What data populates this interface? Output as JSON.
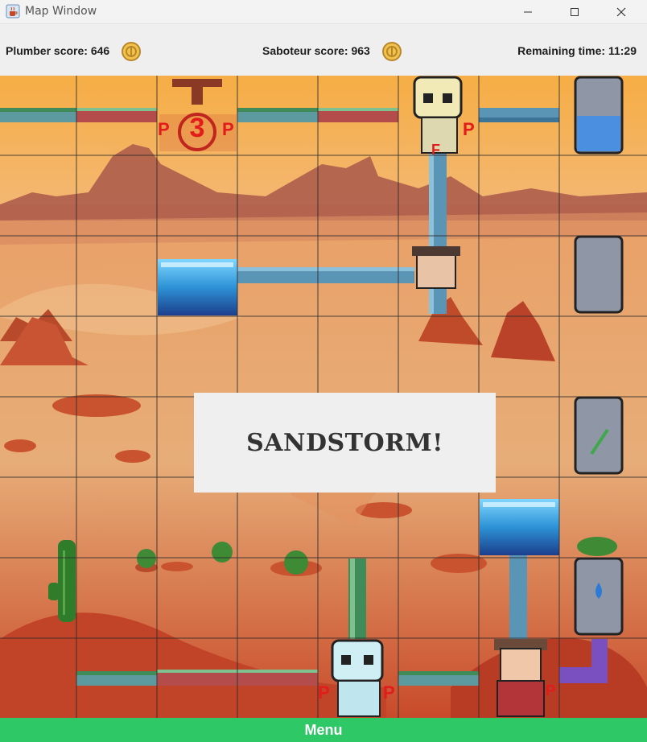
{
  "window": {
    "title": "Map Window",
    "icons": [
      "java-cup-icon",
      "minimize-icon",
      "maximize-icon",
      "close-icon"
    ]
  },
  "scores": {
    "plumber": "Plumber score: 646",
    "saboteur": "Saboteur score: 963",
    "time": "Remaining time: 11:29"
  },
  "board": {
    "grid": {
      "cols": 8,
      "rows": 8
    },
    "icons": [
      "cistern-icon",
      "spring-icon",
      "pump-icon",
      "plumber-icon",
      "saboteur-icon",
      "pipe-icon",
      "cactus-icon",
      "water-pool-icon",
      "coin-icon"
    ],
    "labels": {
      "pump_count": "3",
      "pump_left": "P",
      "pump_right": "P",
      "saboteur_top": "P",
      "saboteur_bottom": "P",
      "saboteur_bottom_left": "P",
      "plumber_small": "F",
      "plumber_bottom": "P"
    }
  },
  "overlay": {
    "text": "SANDSTORM!"
  },
  "menu": {
    "label": "Menu"
  },
  "colors": {
    "accent_green": "#2ec866",
    "sand": "#e8a465",
    "sky": "#f5a94f",
    "water": "#3aa0d8",
    "pipe_blue": "#5b95b5",
    "pipe_red": "#b04a4a",
    "pipe_purple": "#7a4fc0"
  }
}
